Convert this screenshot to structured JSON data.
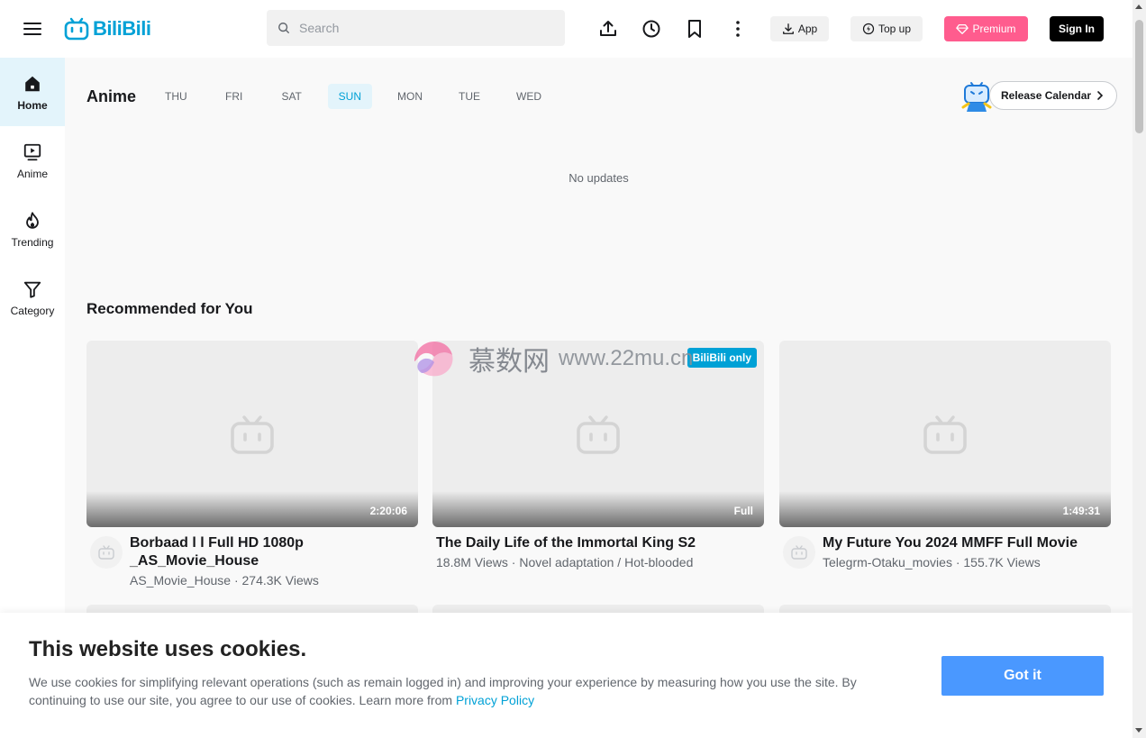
{
  "header": {
    "logo_text": "BiliBili",
    "search_placeholder": "Search",
    "icons": [
      "upload-icon",
      "history-icon",
      "bookmark-icon",
      "more-icon"
    ],
    "app_label": "App",
    "topup_label": "Top up",
    "premium_label": "Premium",
    "signin_label": "Sign In"
  },
  "sidebar": {
    "items": [
      {
        "label": "Home",
        "icon": "home-icon",
        "active": true
      },
      {
        "label": "Anime",
        "icon": "play-icon",
        "active": false
      },
      {
        "label": "Trending",
        "icon": "flame-icon",
        "active": false
      },
      {
        "label": "Category",
        "icon": "filter-icon",
        "active": false
      }
    ]
  },
  "anime": {
    "title": "Anime",
    "days": [
      "THU",
      "FRI",
      "SAT",
      "SUN",
      "MON",
      "TUE",
      "WED"
    ],
    "active_day": "SUN",
    "release_calendar": "Release Calendar",
    "no_updates": "No updates"
  },
  "recommended": {
    "title": "Recommended for You",
    "cards": [
      {
        "title": "Borbaad l l Full HD 1080p _AS_Movie_House",
        "meta": "AS_Movie_House · 274.3K Views",
        "duration": "2:20:06",
        "badge": "",
        "avatar": true
      },
      {
        "title": "The Daily Life of the Immortal King S2",
        "meta": "18.8M Views · Novel adaptation / Hot-blooded",
        "duration": "Full",
        "badge": "BiliBili only",
        "avatar": false
      },
      {
        "title": "My Future You 2024 MMFF Full Movie",
        "meta": "Telegrm-Otaku_movies · 155.7K Views",
        "duration": "1:49:31",
        "badge": "",
        "avatar": true
      }
    ]
  },
  "watermark": {
    "text": "慕数网",
    "url": "www.22mu.cn"
  },
  "cookie": {
    "title": "This website uses cookies.",
    "text": "We use cookies for simplifying relevant operations (such as remain logged in) and improving your experience by measuring how you use the site. By continuing to use our site, you agree to our use of cookies. Learn more from",
    "link": "Privacy Policy",
    "button": "Got it"
  },
  "colors": {
    "brand": "#00a1d6",
    "premium": "#ff5c8e",
    "accent_button": "#4a98ff",
    "active_bg": "#e3f4fb"
  }
}
